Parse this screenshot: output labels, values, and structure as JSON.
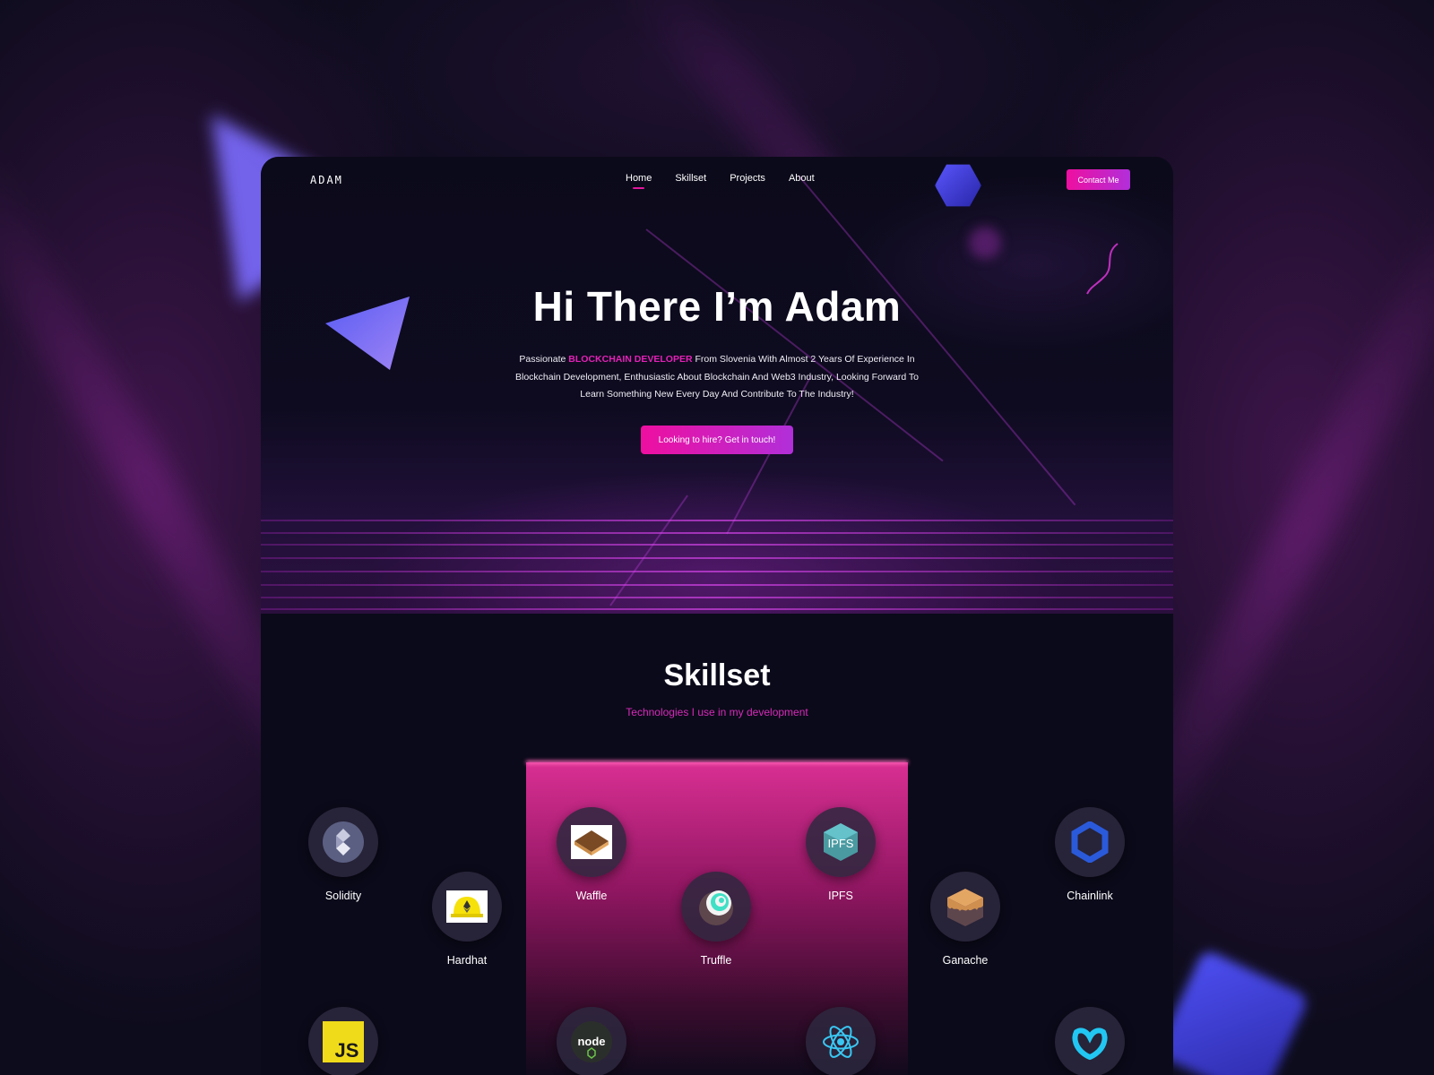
{
  "nav": {
    "logo": "ADAM",
    "links": [
      "Home",
      "Skillset",
      "Projects",
      "About"
    ],
    "active": "Home",
    "contact_label": "Contact Me"
  },
  "hero": {
    "title": "Hi There I’m Adam",
    "desc_prefix": "Passionate ",
    "desc_highlight": "Blockchain Developer",
    "desc_rest": "  From  Slovenia With Almost 2 Years Of Experience In Blockchain Development, Enthusiastic About Blockchain And Web3 Industry, Looking Forward To Learn Something New Every Day And Contribute To The Industry!",
    "cta_label": "Looking to hire? Get in touch!"
  },
  "skillset": {
    "title": "Skillset",
    "subtitle": "Technologies I use in my development",
    "items": [
      {
        "label": "Solidity",
        "icon": "solidity-icon"
      },
      {
        "label": "Hardhat",
        "icon": "hardhat-icon"
      },
      {
        "label": "Waffle",
        "icon": "waffle-icon"
      },
      {
        "label": "Truffle",
        "icon": "truffle-icon"
      },
      {
        "label": "IPFS",
        "icon": "ipfs-icon"
      },
      {
        "label": "Ganache",
        "icon": "ganache-icon"
      },
      {
        "label": "Chainlink",
        "icon": "chainlink-icon"
      },
      {
        "label": "",
        "icon": "javascript-icon"
      },
      {
        "label": "",
        "icon": "nodejs-icon"
      },
      {
        "label": "",
        "icon": "react-icon"
      },
      {
        "label": "",
        "icon": "metamask-icon"
      }
    ],
    "ipfs_text": "IPFS",
    "js_text": "JS",
    "node_text": "node"
  },
  "colors": {
    "accent": "#e3169d",
    "accent_end": "#b12fd9",
    "background": "#0b0a1a"
  }
}
